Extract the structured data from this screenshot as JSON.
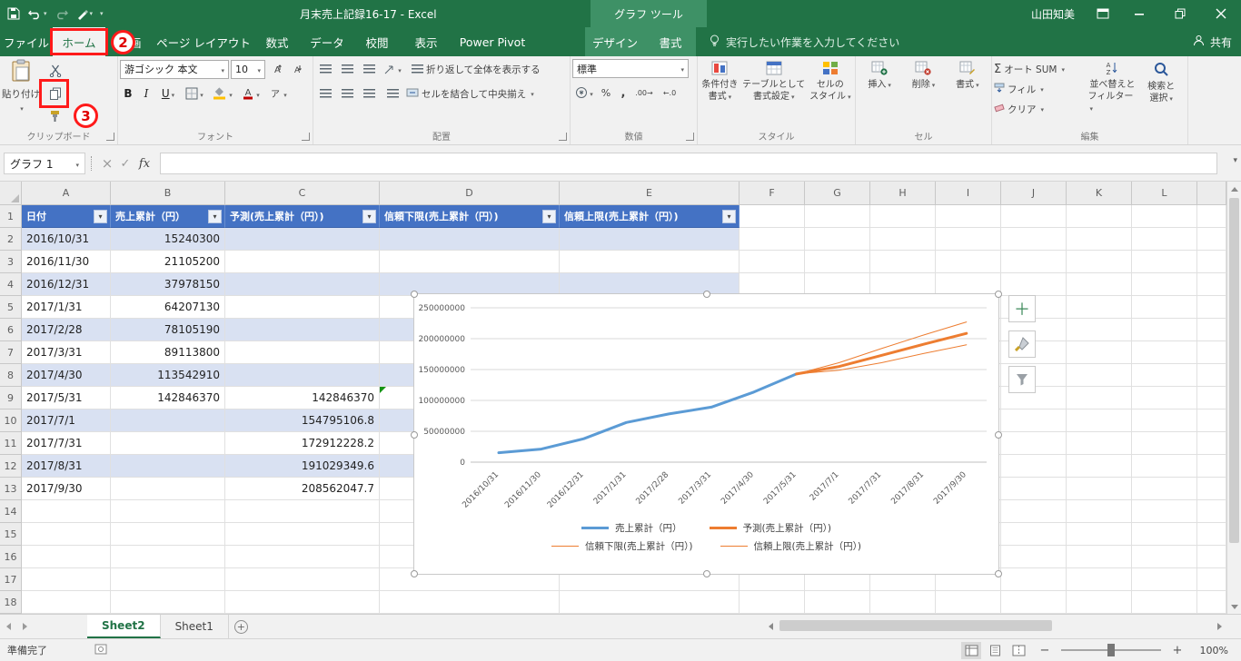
{
  "title_bar": {
    "title": "月末売上記録16-17 - Excel",
    "contextual_title": "グラフ ツール",
    "user_name": "山田知美"
  },
  "ribbon": {
    "tabs": [
      {
        "id": "file",
        "label": "ファイル"
      },
      {
        "id": "home",
        "label": "ホーム",
        "active": true
      },
      {
        "id": "draw",
        "label": "描画"
      },
      {
        "id": "page-layout",
        "label": "ページ レイアウト"
      },
      {
        "id": "formulas",
        "label": "数式"
      },
      {
        "id": "data",
        "label": "データ"
      },
      {
        "id": "review",
        "label": "校閲"
      },
      {
        "id": "view",
        "label": "表示"
      },
      {
        "id": "power-pivot",
        "label": "Power Pivot"
      },
      {
        "id": "design",
        "label": "デザイン",
        "contextual": true,
        "gap_before": true
      },
      {
        "id": "format",
        "label": "書式",
        "contextual": true
      }
    ],
    "search_label": "実行したい作業を入力してください",
    "share_label": "共有",
    "clipboard": {
      "group_label": "クリップボード",
      "paste_label": "貼り付け"
    },
    "font": {
      "group_label": "フォント",
      "font_name": "游ゴシック 本文",
      "font_size": "10",
      "bold_label": "B",
      "italic_label": "I",
      "underline_label": "U"
    },
    "alignment": {
      "group_label": "配置",
      "wrap_label": "折り返して全体を表示する",
      "merge_label": "セルを結合して中央揃え"
    },
    "number": {
      "group_label": "数値",
      "format_label": "標準"
    },
    "styles": {
      "group_label": "スタイル",
      "conditional_line1": "条件付き",
      "conditional_line2": "書式",
      "table_line1": "テーブルとして",
      "table_line2": "書式設定",
      "cell_line1": "セルの",
      "cell_line2": "スタイル"
    },
    "cells": {
      "group_label": "セル",
      "insert_label": "挿入",
      "delete_label": "削除",
      "format_label": "書式"
    },
    "editing": {
      "group_label": "編集",
      "autosum_label": "オート SUM",
      "fill_label": "フィル",
      "clear_label": "クリア",
      "sort_line1": "並べ替えと",
      "sort_line2": "フィルター",
      "find_line1": "検索と",
      "find_line2": "選択"
    }
  },
  "formula_bar": {
    "name_box": "グラフ 1",
    "fx_label": "fx"
  },
  "grid": {
    "columns": [
      "A",
      "B",
      "C",
      "D",
      "E",
      "F",
      "G",
      "H",
      "I",
      "J",
      "K",
      "L"
    ],
    "row_count": 18,
    "table_headers": [
      "日付",
      "売上累計（円）",
      "予測(売上累計（円）)",
      "信頼下限(売上累計（円）)",
      "信頼上限(売上累計（円）)"
    ],
    "rows": [
      [
        "2016/10/31",
        "15240300",
        ""
      ],
      [
        "2016/11/30",
        "21105200",
        ""
      ],
      [
        "2016/12/31",
        "37978150",
        ""
      ],
      [
        "2017/1/31",
        "64207130",
        ""
      ],
      [
        "2017/2/28",
        "78105190",
        ""
      ],
      [
        "2017/3/31",
        "89113800",
        ""
      ],
      [
        "2017/4/30",
        "113542910",
        ""
      ],
      [
        "2017/5/31",
        "142846370",
        "142846370"
      ],
      [
        "2017/7/1",
        "",
        "154795106.8"
      ],
      [
        "2017/7/31",
        "",
        "172912228.2"
      ],
      [
        "2017/8/31",
        "",
        "191029349.6"
      ],
      [
        "2017/9/30",
        "",
        "208562047.7"
      ]
    ]
  },
  "chart_data": {
    "type": "line",
    "categories": [
      "2016/10/31",
      "2016/11/30",
      "2016/12/31",
      "2017/1/31",
      "2017/2/28",
      "2017/3/31",
      "2017/4/30",
      "2017/5/31",
      "2017/7/1",
      "2017/7/31",
      "2017/8/31",
      "2017/9/30"
    ],
    "series": [
      {
        "name": "売上累計（円）",
        "color": "#5B9BD5",
        "width": 3,
        "values": [
          15240300,
          21105200,
          37978150,
          64207130,
          78105190,
          89113800,
          113542910,
          142846370,
          null,
          null,
          null,
          null
        ]
      },
      {
        "name": "予測(売上累計（円）)",
        "color": "#ED7D31",
        "width": 3,
        "values": [
          null,
          null,
          null,
          null,
          null,
          null,
          null,
          142846370,
          154795106.8,
          172912228.2,
          191029349.6,
          208562047.7
        ]
      },
      {
        "name": "信頼下限(売上累計（円）)",
        "color": "#ED7D31",
        "width": 1,
        "values": [
          null,
          null,
          null,
          null,
          null,
          null,
          null,
          142846370,
          149000000,
          161000000,
          176000000,
          190000000
        ]
      },
      {
        "name": "信頼上限(売上累計（円）)",
        "color": "#ED7D31",
        "width": 1,
        "values": [
          null,
          null,
          null,
          null,
          null,
          null,
          null,
          142846370,
          161000000,
          184000000,
          206000000,
          227000000
        ]
      }
    ],
    "ylim": [
      0,
      250000000
    ],
    "ytick_interval": 50000000,
    "grid": true,
    "legend_position": "bottom"
  },
  "sheet_tabs": {
    "tabs": [
      {
        "label": "Sheet2",
        "active": true
      },
      {
        "label": "Sheet1",
        "active": false
      }
    ]
  },
  "status_bar": {
    "ready_label": "準備完了",
    "zoom_level": "100%"
  },
  "annotations": {
    "step2": "2",
    "step3": "3"
  },
  "colors": {
    "excel_green": "#217346",
    "table_header_blue": "#4472C4",
    "band_blue": "#D9E1F2",
    "series_blue": "#5B9BD5",
    "series_orange": "#ED7D31",
    "annotation_red": "#FF1A1A"
  }
}
